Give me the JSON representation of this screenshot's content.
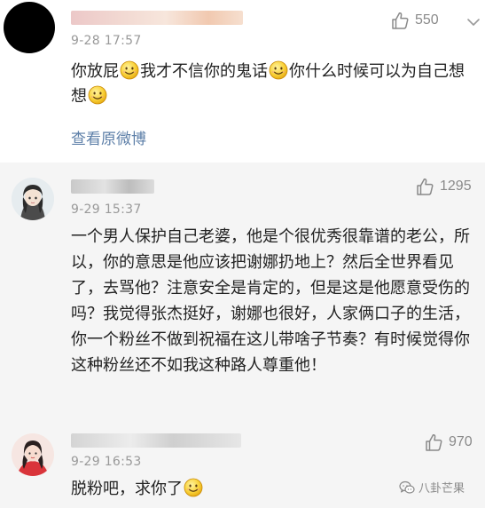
{
  "comments": [
    {
      "time": "9-28 17:57",
      "likes": "550",
      "text_parts": [
        "你放屁",
        "我才不信你的鬼话",
        "你什么时候可以为自己想想"
      ],
      "action_link": "查看原微博"
    },
    {
      "time": "9-29 15:37",
      "likes": "1295",
      "text": "一个男人保护自己老婆，他是个很优秀很靠谱的老公，所以，你的意思是他应该把谢娜扔地上？然后全世界看见了，去骂他？注意安全是肯定的，但是这是他愿意受伤的吗？我觉得张杰挺好，谢娜也很好，人家俩口子的生活，你一个粉丝不做到祝福在这儿带啥子节奏？有时候觉得你这种粉丝还不如我这种路人尊重他！"
    },
    {
      "time": "9-29 16:53",
      "likes": "970",
      "text_parts": [
        "脱粉吧，求你了"
      ]
    }
  ],
  "watermark": "八卦芒果",
  "icons": {
    "like": "thumbs-up-icon",
    "more": "chevron-down-icon",
    "emoji": "smile-emoji-icon",
    "watermark": "wechat-icon"
  },
  "colors": {
    "link": "#5d7fa8",
    "meta": "#999999",
    "section_bg": "#f5f5f5"
  }
}
